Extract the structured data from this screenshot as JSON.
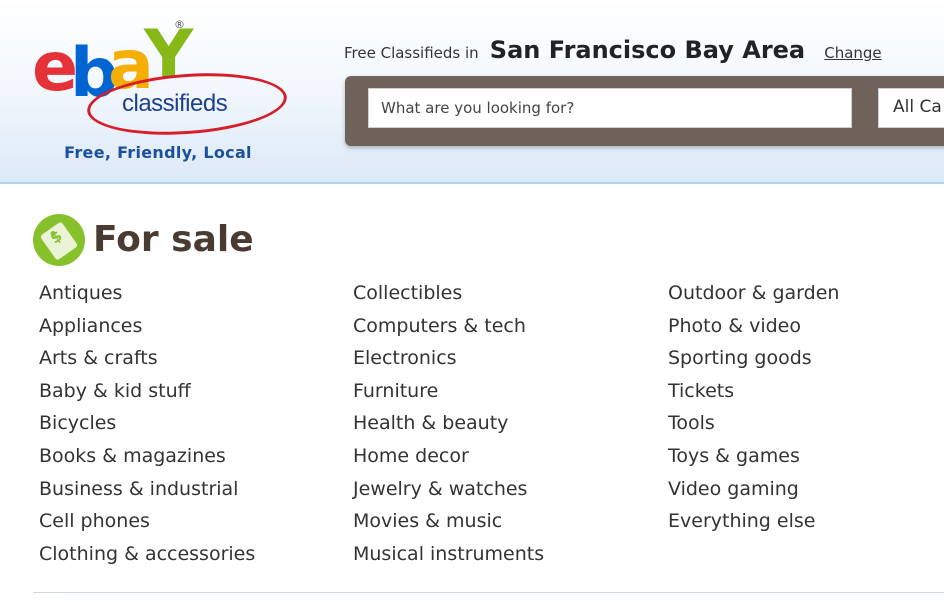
{
  "header": {
    "logo": {
      "brand": "ebay",
      "letters": [
        "e",
        "b",
        "a",
        "Y"
      ],
      "registered_mark": "®",
      "sub_brand": "classifieds"
    },
    "tagline": "Free, Friendly, Local",
    "location": {
      "prefix": "Free Classifieds in",
      "name": "San Francisco Bay Area",
      "change_label": "Change"
    },
    "search": {
      "placeholder": "What are you looking for?",
      "category_value": "All Ca"
    }
  },
  "section": {
    "title": "For sale",
    "icon": "price-tag-icon",
    "columns": [
      [
        "Antiques",
        "Appliances",
        "Arts & crafts",
        "Baby & kid stuff",
        "Bicycles",
        "Books & magazines",
        "Business & industrial",
        "Cell phones",
        "Clothing & accessories"
      ],
      [
        "Collectibles",
        "Computers & tech",
        "Electronics",
        "Furniture",
        "Health & beauty",
        "Home decor",
        "Jewelry & watches",
        "Movies & music",
        "Musical instruments"
      ],
      [
        "Outdoor & garden",
        "Photo & video",
        "Sporting goods",
        "Tickets",
        "Tools",
        "Toys & games",
        "Video gaming",
        "Everything else"
      ]
    ]
  },
  "colors": {
    "ebay_e": "#e53238",
    "ebay_b": "#0064d2",
    "ebay_a": "#f5af02",
    "ebay_y": "#86b817",
    "ellipse": "#d61e2b",
    "tagline": "#1c4f9c",
    "search_frame": "#6f625a",
    "icon_green": "#86c12c"
  }
}
